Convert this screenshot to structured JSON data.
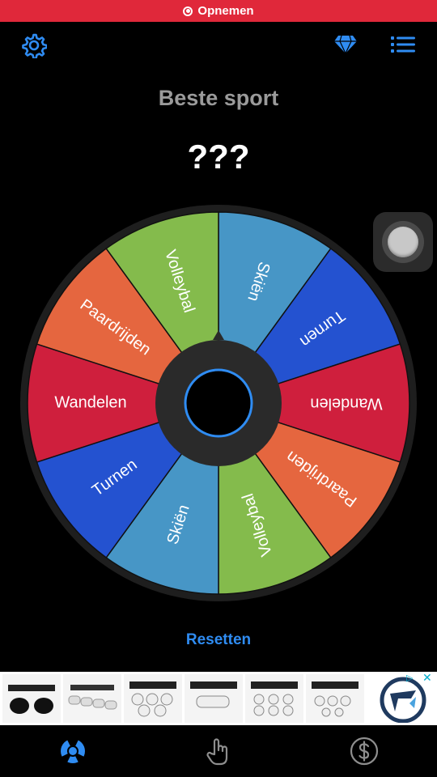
{
  "recording": {
    "label": "Opnemen"
  },
  "header": {
    "settings_icon": "gear-icon",
    "premium_icon": "diamond-icon",
    "list_icon": "list-icon"
  },
  "wheel": {
    "title": "Beste sport",
    "result": "???",
    "segments": [
      {
        "label": "Skiën",
        "color": "#4796c6"
      },
      {
        "label": "Turnen",
        "color": "#2452d0"
      },
      {
        "label": "Wandelen",
        "color": "#cf1f3d"
      },
      {
        "label": "Paardrijden",
        "color": "#e5663f"
      },
      {
        "label": "Volleybal",
        "color": "#84bb4c"
      },
      {
        "label": "Skiën",
        "color": "#4796c6"
      },
      {
        "label": "Turnen",
        "color": "#2452d0"
      },
      {
        "label": "Wandelen",
        "color": "#cf1f3d"
      },
      {
        "label": "Paardrijden",
        "color": "#e5663f"
      },
      {
        "label": "Volleybal",
        "color": "#84bb4c"
      }
    ]
  },
  "reset_label": "Resetten",
  "colors": {
    "accent": "#2f8cf2",
    "record_bar": "#e0283a"
  },
  "tabs": [
    {
      "icon": "wheel-icon",
      "active": true
    },
    {
      "icon": "hand-pointer-icon",
      "active": false
    },
    {
      "icon": "dollar-icon",
      "active": false
    }
  ]
}
